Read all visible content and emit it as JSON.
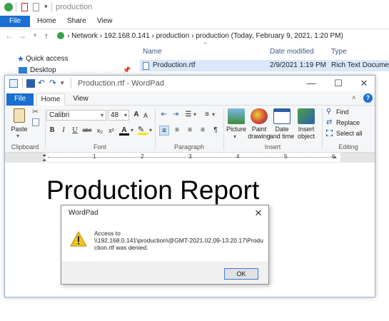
{
  "explorer": {
    "title": "production",
    "ribbon_tabs": [
      "File",
      "Home",
      "Share",
      "View"
    ],
    "address": [
      "Network",
      "192.168.0.141",
      "production",
      "production (Today, February 9, 2021, 1:20 PM)"
    ],
    "nav": {
      "quick_access": "Quick access",
      "desktop": "Desktop"
    },
    "columns": {
      "name": "Name",
      "date_modified": "Date modified",
      "type": "Type"
    },
    "file": {
      "name": "Production.rtf",
      "date_modified": "2/9/2021 1:19 PM",
      "type": "Rich Text Docume"
    }
  },
  "wordpad": {
    "title": "Production.rtf - WordPad",
    "tabs": [
      "File",
      "Home",
      "View"
    ],
    "font_name": "Calibri",
    "font_size": "48",
    "groups": {
      "clipboard": "Clipboard",
      "font": "Font",
      "paragraph": "Paragraph",
      "insert": "Insert",
      "editing": "Editing"
    },
    "paste_label": "Paste",
    "insert_buttons": [
      "Picture",
      "Paint drawing",
      "Date and time",
      "Insert object"
    ],
    "editing_buttons": [
      "Find",
      "Replace",
      "Select all"
    ],
    "ruler_numbers": [
      "1",
      "2",
      "3",
      "4",
      "5",
      "6"
    ],
    "document_heading": "Production Report"
  },
  "dialog": {
    "title": "WordPad",
    "message_lines": [
      "Access to",
      "\\\\192.168.0.141\\production\\@GMT-2021.02.09-13.20.17\\Produ",
      "ction.rtf was denied."
    ],
    "ok_label": "OK"
  },
  "colors": {
    "accent": "#1a6fd0",
    "selection": "#d9e8fb",
    "warning": "#f2c21b"
  }
}
